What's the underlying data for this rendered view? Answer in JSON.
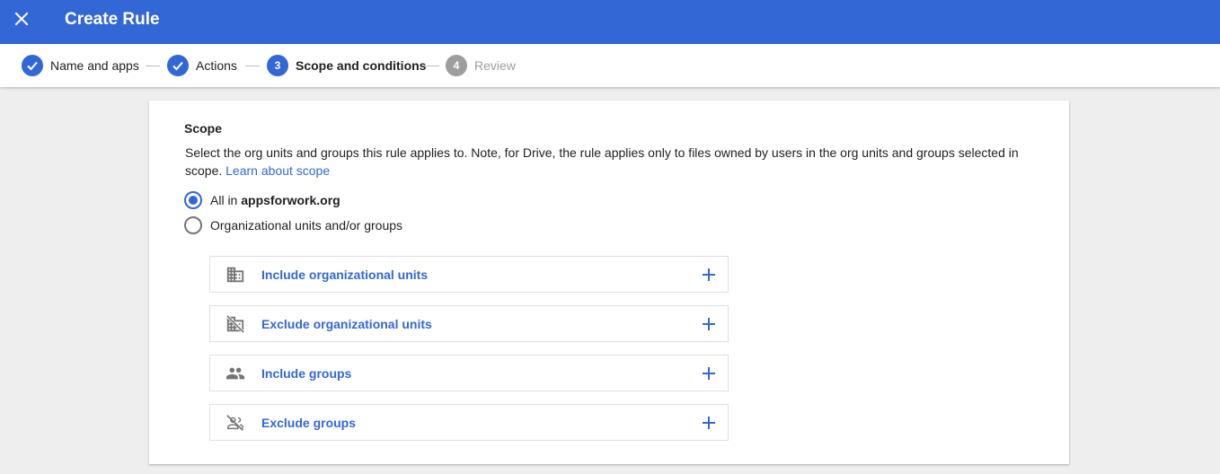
{
  "header": {
    "title": "Create Rule",
    "close_icon": "close-icon",
    "background": "#3367d6"
  },
  "stepper": {
    "steps": [
      {
        "label": "Name and apps",
        "state": "done"
      },
      {
        "label": "Actions",
        "state": "done"
      },
      {
        "number": "3",
        "label": "Scope and conditions",
        "state": "active"
      },
      {
        "number": "4",
        "label": "Review",
        "state": "pending"
      }
    ]
  },
  "scope": {
    "title": "Scope",
    "description": "Select the org units and groups this rule applies to. Note, for Drive, the rule applies only to files owned by users in the org units and groups selected in scope.",
    "learn_more": "Learn about scope",
    "options": [
      {
        "prefix": "All in",
        "domain": "appsforwork.org",
        "selected": true
      },
      {
        "label": "Organizational units and/or groups",
        "selected": false
      }
    ],
    "items": [
      {
        "label": "Include organizational units",
        "icon": "building-icon"
      },
      {
        "label": "Exclude organizational units",
        "icon": "building-off-icon"
      },
      {
        "label": "Include groups",
        "icon": "group-icon"
      },
      {
        "label": "Exclude groups",
        "icon": "group-off-icon"
      }
    ]
  },
  "colors": {
    "accent": "#3367d6",
    "pending": "#9e9e9e",
    "background": "#eeeeee"
  }
}
